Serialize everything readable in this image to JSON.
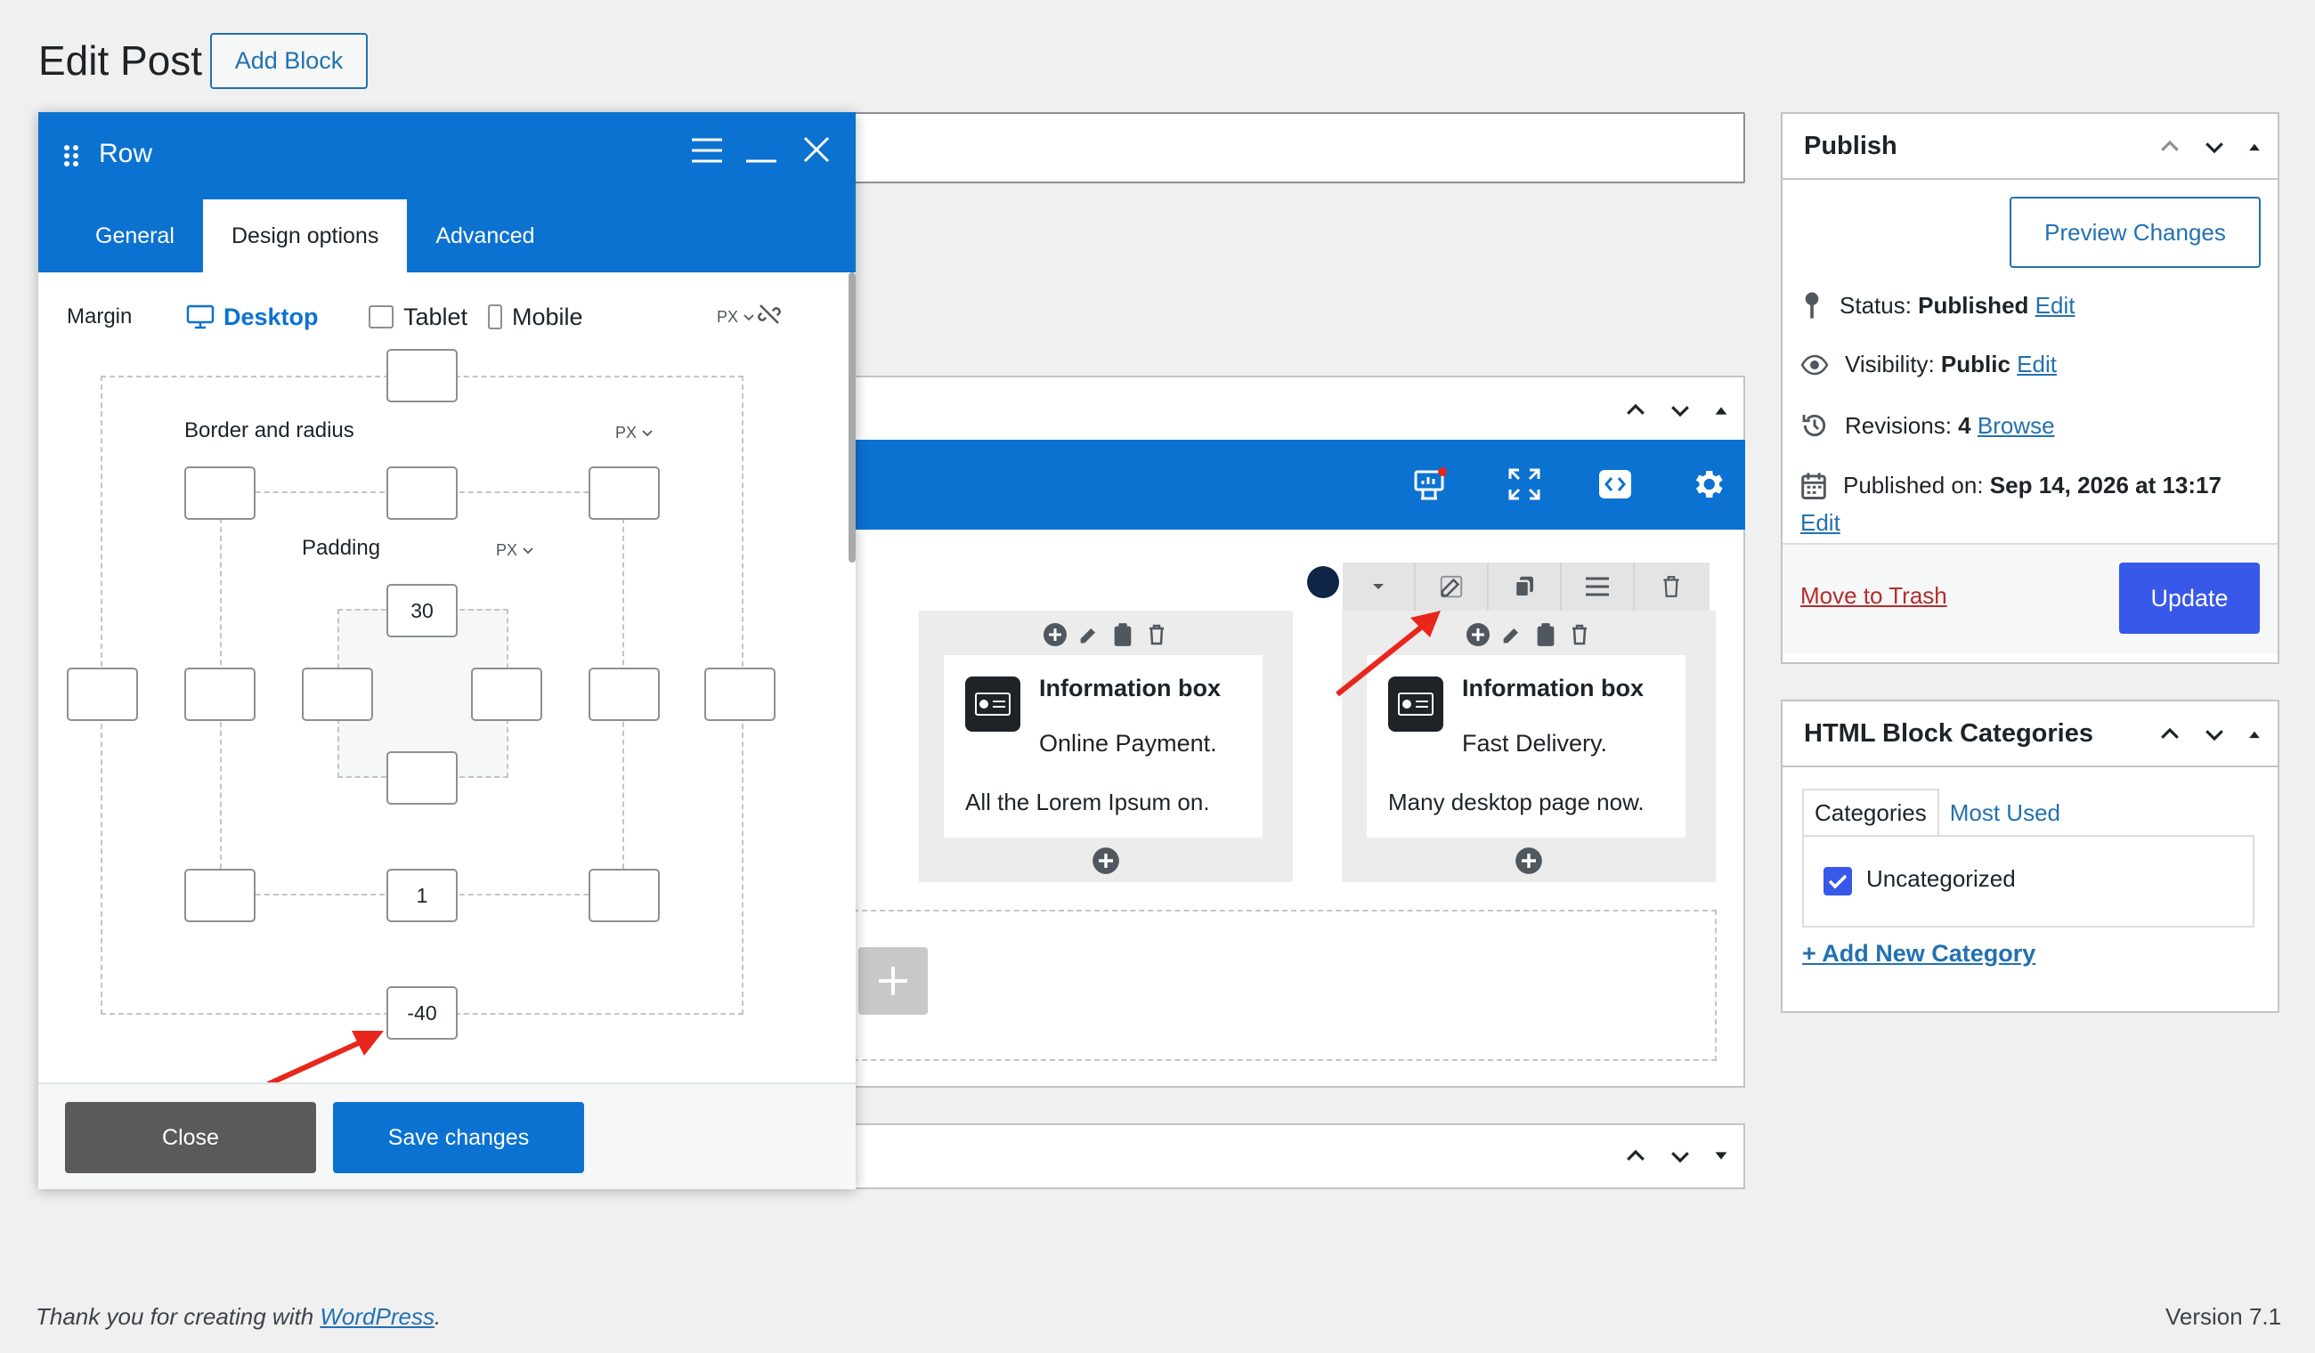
{
  "header": {
    "title": "Edit Post",
    "add_block": "Add Block"
  },
  "row_panel": {
    "title": "Row",
    "tabs": [
      {
        "label": "General",
        "active": false
      },
      {
        "label": "Design options",
        "active": true
      },
      {
        "label": "Advanced",
        "active": false
      }
    ],
    "margin_label": "Margin",
    "devices": {
      "desktop": "Desktop",
      "tablet": "Tablet",
      "mobile": "Mobile"
    },
    "unit": "PX",
    "border_label": "Border and radius",
    "padding_label": "Padding",
    "values": {
      "margin_top": "",
      "margin_left": "",
      "margin_right": "",
      "margin_bottom": "-40",
      "border_top_left": "",
      "border_top": "",
      "border_top_right": "",
      "border_left": "",
      "border_right": "",
      "border_bottom_left": "",
      "border_bottom": "1",
      "border_bottom_right": "",
      "padding_top": "30",
      "padding_left": "",
      "padding_right": "",
      "padding_bottom": ""
    },
    "close": "Close",
    "save": "Save changes"
  },
  "canvas": {
    "columns": [
      {
        "title": "Information box",
        "subtitle": "Online Payment.",
        "description": "All the Lorem Ipsum on."
      },
      {
        "title": "Information box",
        "subtitle": "Fast Delivery.",
        "description": "Many desktop page now."
      }
    ]
  },
  "publish": {
    "title": "Publish",
    "preview": "Preview Changes",
    "status_label": "Status:",
    "status_value": "Published",
    "visibility_label": "Visibility:",
    "visibility_value": "Public",
    "revisions_label": "Revisions:",
    "revisions_value": "4",
    "browse": "Browse",
    "published_on_label": "Published on:",
    "published_on_value": "Sep 14, 2026 at 13:17",
    "edit": "Edit",
    "trash": "Move to Trash",
    "update": "Update"
  },
  "categories": {
    "title": "HTML Block Categories",
    "tabs": [
      "Categories",
      "Most Used"
    ],
    "items": [
      {
        "label": "Uncategorized",
        "checked": true
      }
    ],
    "add_new": "+ Add New Category"
  },
  "footer": {
    "thanks_prefix": "Thank you for creating with ",
    "wordpress": "WordPress",
    "period": ".",
    "version": "Version 7.1"
  },
  "colors": {
    "accent": "#0b72d1",
    "wp_blue": "#2271b1",
    "update": "#3858e9",
    "trash": "#b32d2e",
    "arrow": "#e8261c"
  }
}
